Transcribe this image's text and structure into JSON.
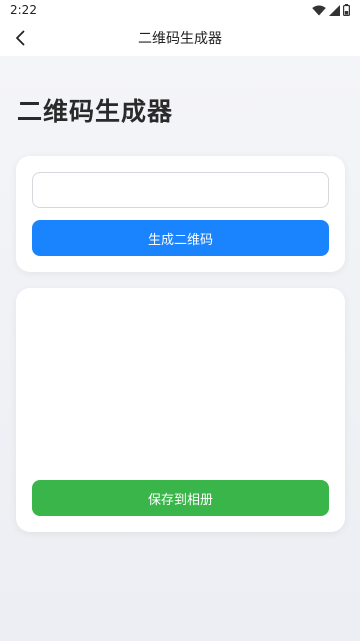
{
  "status_bar": {
    "time": "2:22",
    "icons": [
      "wifi-icon",
      "signal-icon",
      "battery-icon"
    ]
  },
  "nav": {
    "title": "二维码生成器",
    "back_icon": "chevron-left-icon"
  },
  "page": {
    "title": "二维码生成器"
  },
  "input_card": {
    "input_value": "",
    "input_placeholder": "",
    "generate_label": "生成二维码"
  },
  "preview_card": {
    "save_label": "保存到相册"
  },
  "colors": {
    "primary": "#1a84ff",
    "success": "#3ab54a",
    "background": "#eef0f4",
    "card": "#ffffff"
  }
}
